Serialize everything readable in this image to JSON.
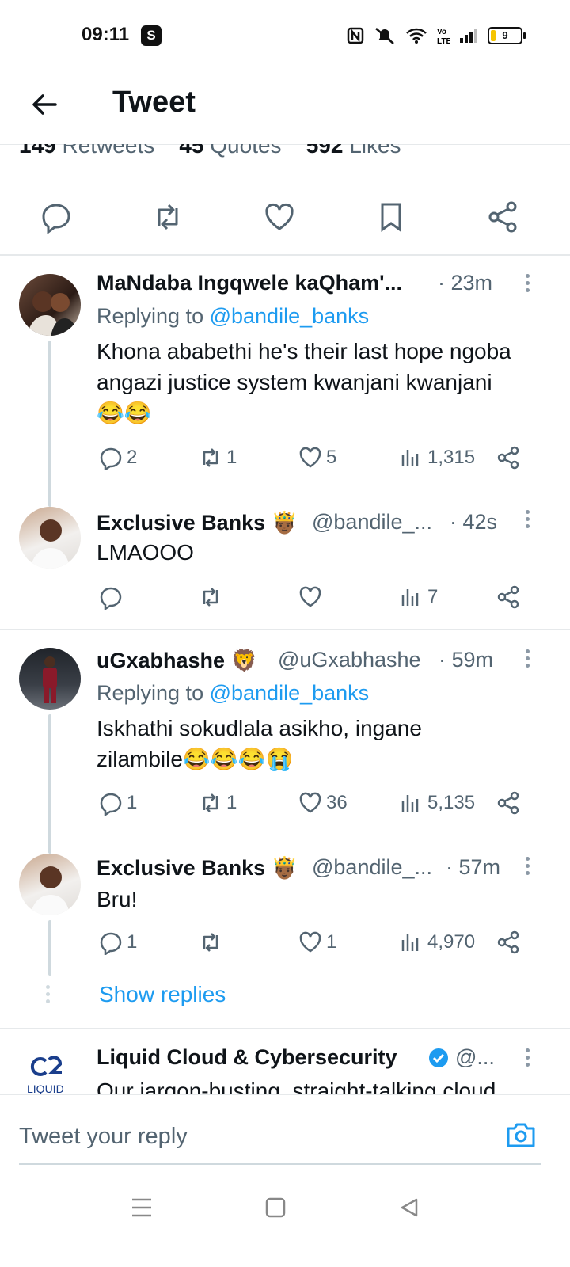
{
  "status_bar": {
    "time": "09:11",
    "app_badge": "S",
    "battery": "9"
  },
  "header": {
    "title": "Tweet"
  },
  "stats": {
    "retweets_count": "149",
    "retweets_label": "Retweets",
    "quotes_count": "45",
    "quotes_label": "Quotes",
    "likes_count": "592",
    "likes_label": "Likes"
  },
  "replies": [
    {
      "name": "MaNdaba Ingqwele kaQham'...",
      "time": "· 23m",
      "replying_prefix": "Replying to ",
      "replying_handle": "@bandile_banks",
      "text": "Khona ababethi he's their last hope ngoba angazi justice system kwanjani kwanjani 😂😂",
      "replies": "2",
      "retweets": "1",
      "likes": "5",
      "views": "1,315"
    },
    {
      "name": "Exclusive Banks",
      "emoji": "🤴🏾",
      "handle": "@bandile_...",
      "time": "· 42s",
      "text": "LMAOOO",
      "replies": "",
      "retweets": "",
      "likes": "",
      "views": "7"
    },
    {
      "name": "uGxabhashe",
      "emoji": "🦁",
      "handle": "@uGxabhashe",
      "time": "· 59m",
      "replying_prefix": "Replying to ",
      "replying_handle": "@bandile_banks",
      "text": "Iskhathi sokudlala asikho, ingane zilambile😂😂😂😭",
      "replies": "1",
      "retweets": "1",
      "likes": "36",
      "views": "5,135"
    },
    {
      "name": "Exclusive Banks",
      "emoji": "🤴🏾",
      "handle": "@bandile_...",
      "time": "· 57m",
      "text": "Bru!",
      "replies": "1",
      "retweets": "",
      "likes": "1",
      "views": "4,970"
    }
  ],
  "show_replies": "Show replies",
  "promoted": {
    "name": "Liquid Cloud & Cybersecurity",
    "handle": "@...",
    "text": "Our jargon-busting, straight-talking cloud",
    "logo_text": "LIQUID"
  },
  "compose": {
    "placeholder": "Tweet your reply"
  },
  "colors": {
    "accent": "#1d9bf0",
    "text": "#0f1419",
    "secondary": "#536471",
    "divider": "#e6e9eb"
  }
}
